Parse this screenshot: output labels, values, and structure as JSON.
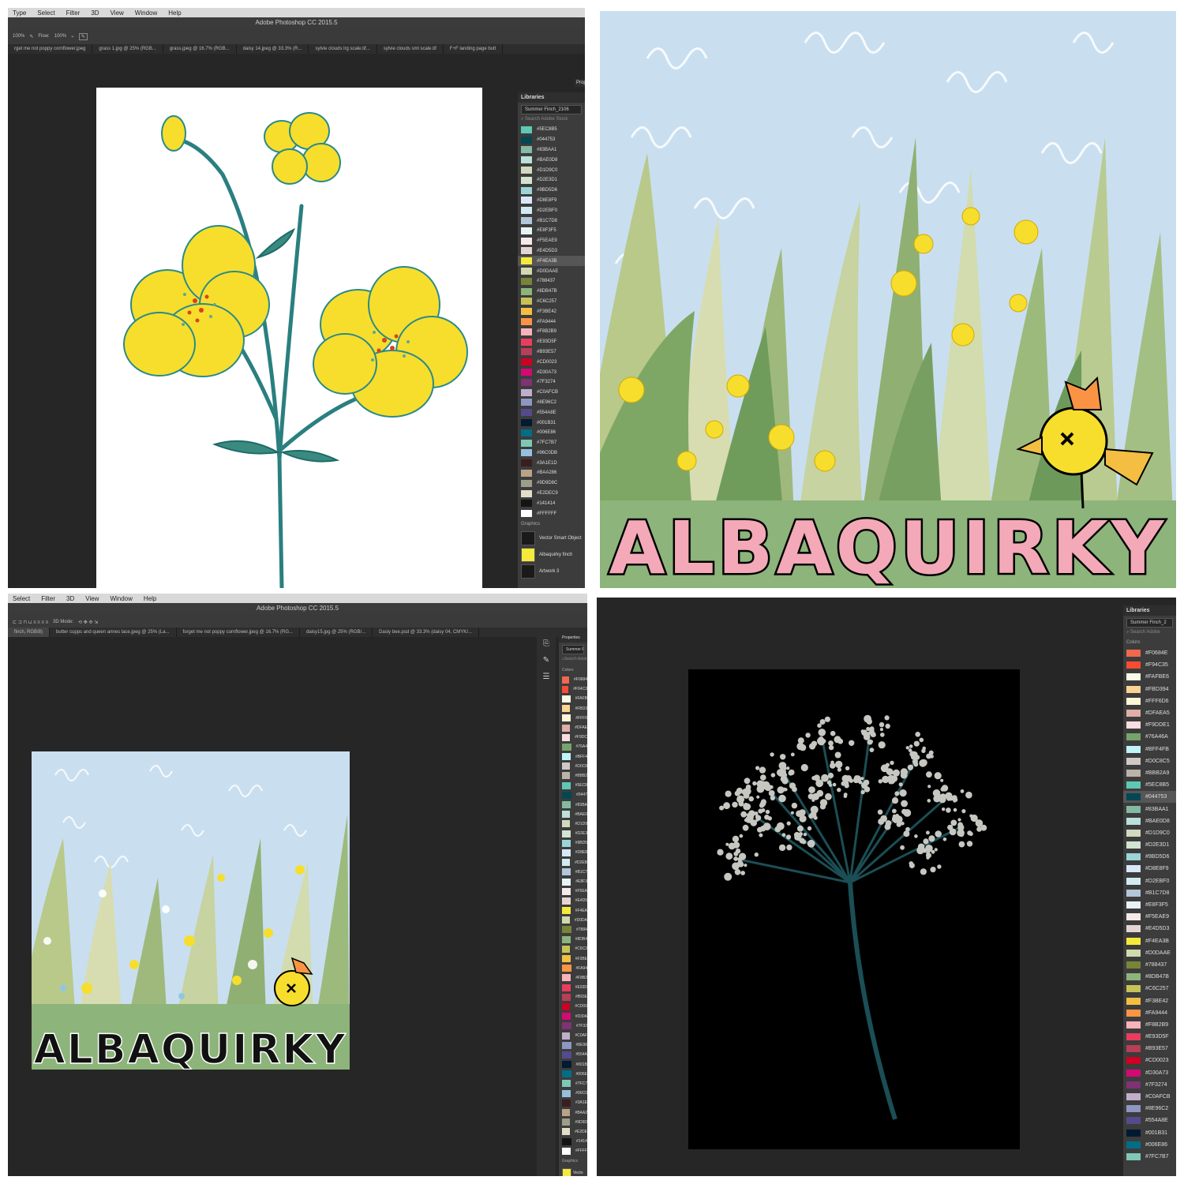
{
  "q1": {
    "menu": [
      "Type",
      "Select",
      "Filter",
      "3D",
      "View",
      "Window",
      "Help"
    ],
    "title": "Adobe Photoshop CC 2015.5",
    "options": {
      "opacity_value": "100%",
      "flow_label": "Flow:",
      "flow_value": "100%"
    },
    "tabs": [
      "rget me not poppy cornflower.jpeg",
      "grass 1.jpg @ 25% (RGB...",
      "grass.jpeg @ 16.7% (RGB...",
      "daisy 14.jpeg @ 33.3% (R...",
      "sylvie clouds lrg scale.tif...",
      "sylvie clouds sml scale.tif",
      "F+F landing page butt"
    ],
    "panel": {
      "header": "Libraries",
      "library": "Summer Finch_2106",
      "search_placeholder": "Search Adobe Stock",
      "prop_tab": "Prop"
    },
    "swatches": [
      {
        "label": "#5EC8B5",
        "color": "#5EC8B5"
      },
      {
        "label": "#044753",
        "color": "#044753"
      },
      {
        "label": "#83BAA1",
        "color": "#83BAA1"
      },
      {
        "label": "#BAE0D8",
        "color": "#BAE0D8"
      },
      {
        "label": "#D1D9C0",
        "color": "#D1D9C0"
      },
      {
        "label": "#D2E3D1",
        "color": "#D2E3D1"
      },
      {
        "label": "#9BD5D6",
        "color": "#9BD5D6"
      },
      {
        "label": "#D8E8F9",
        "color": "#D8E8F9"
      },
      {
        "label": "#D2EBF0",
        "color": "#D2EBF0"
      },
      {
        "label": "#B1C7D8",
        "color": "#B1C7D8"
      },
      {
        "label": "#E8F3F5",
        "color": "#E8F3F5"
      },
      {
        "label": "#F5EAE9",
        "color": "#F5EAE9"
      },
      {
        "label": "#E4D5D3",
        "color": "#E4D5D3"
      },
      {
        "label": "#F4EA3B",
        "color": "#F4EA3B"
      },
      {
        "label": "#D0DAAE",
        "color": "#D0DAAE"
      },
      {
        "label": "#788437",
        "color": "#788437"
      },
      {
        "label": "#8DB47B",
        "color": "#8DB47B"
      },
      {
        "label": "#C6C257",
        "color": "#C6C257"
      },
      {
        "label": "#F3BE42",
        "color": "#F3BE42"
      },
      {
        "label": "#FA9444",
        "color": "#FA9444"
      },
      {
        "label": "#F8B2B9",
        "color": "#F8B2B9"
      },
      {
        "label": "#E93D5F",
        "color": "#E93D5F"
      },
      {
        "label": "#B93E57",
        "color": "#B93E57"
      },
      {
        "label": "#CD0023",
        "color": "#CD0023"
      },
      {
        "label": "#D30A73",
        "color": "#D30A73"
      },
      {
        "label": "#7F3274",
        "color": "#7F3274"
      },
      {
        "label": "#C0AFCB",
        "color": "#C0AFCB"
      },
      {
        "label": "#8E96C2",
        "color": "#8E96C2"
      },
      {
        "label": "#554A8E",
        "color": "#554A8E"
      },
      {
        "label": "#001B31",
        "color": "#001B31"
      },
      {
        "label": "#006E86",
        "color": "#006E86"
      },
      {
        "label": "#7FC7B7",
        "color": "#7FC7B7"
      },
      {
        "label": "#96C0DB",
        "color": "#96C0DB"
      },
      {
        "label": "#3A1E1D",
        "color": "#3A1E1D"
      },
      {
        "label": "#BAA286",
        "color": "#BAA286"
      },
      {
        "label": "#9D9D8C",
        "color": "#9D9D8C"
      },
      {
        "label": "#E2DEC9",
        "color": "#E2DEC9"
      },
      {
        "label": "#141414",
        "color": "#141414"
      },
      {
        "label": "#FFFFFF",
        "color": "#FFFFFF"
      }
    ],
    "selected_swatch": "#F4EA3B",
    "graphics_header": "Graphics",
    "graphics": [
      "Vector Smart Object",
      "Albaquirky finch",
      "Artwork 3"
    ]
  },
  "q2": {
    "wordmark": "ALBAQUIRKY"
  },
  "q3": {
    "menu": [
      "Select",
      "Filter",
      "3D",
      "View",
      "Window",
      "Help"
    ],
    "title": "Adobe Photoshop CC 2015.5",
    "mode_label": "3D Mode:",
    "tabs": [
      "finch, RGB/8)",
      "butter cupps and queen annes lace.jpeg @ 25% (La...",
      "forget me not poppy cornflower.jpeg @ 16.7% (RG...",
      "daisy15.jpg @ 25% (RGB/...",
      "Dasiy bee.psd @ 33.3% (daisy 04, CMYK/..."
    ],
    "panel": {
      "header": "Properties",
      "library": "Summer Finch",
      "search_placeholder": "Search Adob",
      "colors_header": "Colors"
    },
    "swatches": [
      {
        "label": "#F0684",
        "color": "#F0684E"
      },
      {
        "label": "#F94C3",
        "color": "#F94C35"
      },
      {
        "label": "#FAFB",
        "color": "#FAFBE6"
      },
      {
        "label": "#FBD3",
        "color": "#FBD394"
      },
      {
        "label": "#FFF6",
        "color": "#FFF6D6"
      },
      {
        "label": "#DFAE",
        "color": "#DFAEA5"
      },
      {
        "label": "#F9DC",
        "color": "#F9DDE1"
      },
      {
        "label": "#76A4",
        "color": "#76A46A"
      },
      {
        "label": "#BFF4",
        "color": "#BFF4FB"
      },
      {
        "label": "#D0C8",
        "color": "#D0C8C5"
      },
      {
        "label": "#BBB2",
        "color": "#BBB2A9"
      },
      {
        "label": "#5EC8",
        "color": "#5EC8B5"
      },
      {
        "label": "#0447",
        "color": "#044753"
      },
      {
        "label": "#83BA",
        "color": "#83BAA1"
      },
      {
        "label": "#BAE0",
        "color": "#BAE0D8"
      },
      {
        "label": "#D1D9",
        "color": "#D1D9C0"
      },
      {
        "label": "#D2E3",
        "color": "#D2E3D1"
      },
      {
        "label": "#9BD5",
        "color": "#9BD5D6"
      },
      {
        "label": "#D8E8",
        "color": "#D8E8F9"
      },
      {
        "label": "#D2EB",
        "color": "#D2EBF0"
      },
      {
        "label": "#B1C7",
        "color": "#B1C7D8"
      },
      {
        "label": "#E8F3",
        "color": "#E8F3F5"
      },
      {
        "label": "#F5EA",
        "color": "#F5EAE9"
      },
      {
        "label": "#E4D5",
        "color": "#E4D5D3"
      },
      {
        "label": "#F4EA",
        "color": "#F4EA3B"
      },
      {
        "label": "#D0DA",
        "color": "#D0DAAE"
      },
      {
        "label": "#7884",
        "color": "#788437"
      },
      {
        "label": "#8DB4",
        "color": "#8DB47B"
      },
      {
        "label": "#C6C2",
        "color": "#C6C257"
      },
      {
        "label": "#F3BE",
        "color": "#F3BE42"
      },
      {
        "label": "#FA94",
        "color": "#FA9444"
      },
      {
        "label": "#F8B2",
        "color": "#F8B2B9"
      },
      {
        "label": "#E93D",
        "color": "#E93D5F"
      },
      {
        "label": "#B93E",
        "color": "#B93E57"
      },
      {
        "label": "#CD00",
        "color": "#CD0023"
      },
      {
        "label": "#D30A",
        "color": "#D30A73"
      },
      {
        "label": "#7F32",
        "color": "#7F3274"
      },
      {
        "label": "#C0AF",
        "color": "#C0AFCB"
      },
      {
        "label": "#8E96",
        "color": "#8E96C2"
      },
      {
        "label": "#554A",
        "color": "#554A8E"
      },
      {
        "label": "#001B",
        "color": "#001B31"
      },
      {
        "label": "#006E",
        "color": "#006E86"
      },
      {
        "label": "#7FC7",
        "color": "#7FC7B7"
      },
      {
        "label": "#96C0",
        "color": "#96C0DB"
      },
      {
        "label": "#3A1E",
        "color": "#3A1E1D"
      },
      {
        "label": "#BAA2",
        "color": "#BAA286"
      },
      {
        "label": "#9D9D",
        "color": "#9D9D8C"
      },
      {
        "label": "#E2DE",
        "color": "#E2DEC9"
      },
      {
        "label": "#1414",
        "color": "#141414"
      },
      {
        "label": "#FFFF",
        "color": "#FFFFFF"
      }
    ],
    "graphics_header": "Graphics",
    "graphics": [
      "Vecto"
    ],
    "wordmark": "ALBAQUIRKY"
  },
  "q4": {
    "panel": {
      "header": "Libraries",
      "library": "Summer Finch_2",
      "search_placeholder": "Search Adobe",
      "colors_header": "Colors"
    },
    "swatches": [
      {
        "label": "#F0684E",
        "color": "#F0684E"
      },
      {
        "label": "#F94C35",
        "color": "#F94C35"
      },
      {
        "label": "#FAFBE6",
        "color": "#FAFBE6"
      },
      {
        "label": "#FBD394",
        "color": "#FBD394"
      },
      {
        "label": "#FFF6D6",
        "color": "#FFF6D6"
      },
      {
        "label": "#DFAEA5",
        "color": "#DFAEA5"
      },
      {
        "label": "#F9DDE1",
        "color": "#F9DDE1"
      },
      {
        "label": "#76A46A",
        "color": "#76A46A"
      },
      {
        "label": "#BFF4FB",
        "color": "#BFF4FB"
      },
      {
        "label": "#D0C8C5",
        "color": "#D0C8C5"
      },
      {
        "label": "#BBB2A9",
        "color": "#BBB2A9"
      },
      {
        "label": "#5EC8B5",
        "color": "#5EC8B5"
      },
      {
        "label": "#044753",
        "color": "#044753"
      },
      {
        "label": "#83BAA1",
        "color": "#83BAA1"
      },
      {
        "label": "#BAE0D8",
        "color": "#BAE0D8"
      },
      {
        "label": "#D1D9C0",
        "color": "#D1D9C0"
      },
      {
        "label": "#D2E3D1",
        "color": "#D2E3D1"
      },
      {
        "label": "#9BD5D6",
        "color": "#9BD5D6"
      },
      {
        "label": "#D8E8F9",
        "color": "#D8E8F9"
      },
      {
        "label": "#D2EBF0",
        "color": "#D2EBF0"
      },
      {
        "label": "#B1C7D8",
        "color": "#B1C7D8"
      },
      {
        "label": "#E8F3F5",
        "color": "#E8F3F5"
      },
      {
        "label": "#F5EAE9",
        "color": "#F5EAE9"
      },
      {
        "label": "#E4D5D3",
        "color": "#E4D5D3"
      },
      {
        "label": "#F4EA3B",
        "color": "#F4EA3B"
      },
      {
        "label": "#D0DAAE",
        "color": "#D0DAAE"
      },
      {
        "label": "#788437",
        "color": "#788437"
      },
      {
        "label": "#8DB47B",
        "color": "#8DB47B"
      },
      {
        "label": "#C6C257",
        "color": "#C6C257"
      },
      {
        "label": "#F3BE42",
        "color": "#F3BE42"
      },
      {
        "label": "#FA9444",
        "color": "#FA9444"
      },
      {
        "label": "#F8B2B9",
        "color": "#F8B2B9"
      },
      {
        "label": "#E93D5F",
        "color": "#E93D5F"
      },
      {
        "label": "#B93E57",
        "color": "#B93E57"
      },
      {
        "label": "#CD0023",
        "color": "#CD0023"
      },
      {
        "label": "#D30A73",
        "color": "#D30A73"
      },
      {
        "label": "#7F3274",
        "color": "#7F3274"
      },
      {
        "label": "#C0AFCB",
        "color": "#C0AFCB"
      },
      {
        "label": "#8E96C2",
        "color": "#8E96C2"
      },
      {
        "label": "#554A8E",
        "color": "#554A8E"
      },
      {
        "label": "#001B31",
        "color": "#001B31"
      },
      {
        "label": "#006E86",
        "color": "#006E86"
      },
      {
        "label": "#7FC7B7",
        "color": "#7FC7B7"
      }
    ],
    "selected_swatch": "#044753"
  }
}
